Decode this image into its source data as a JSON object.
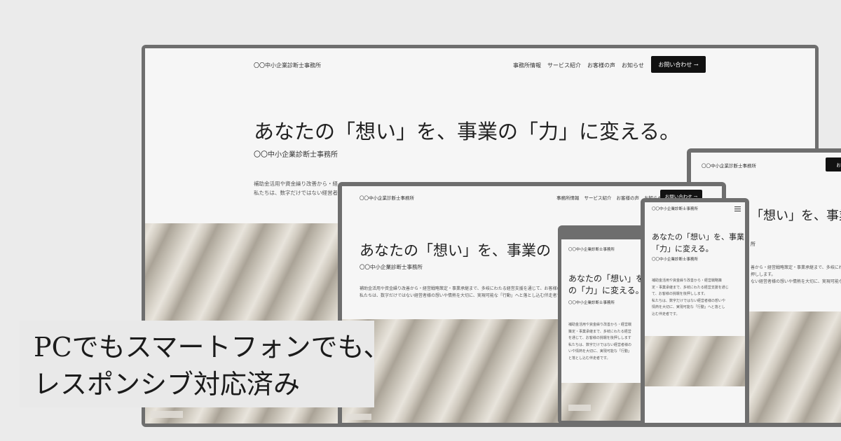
{
  "site": {
    "logo": "〇〇中小企業診断士事務所",
    "nav": [
      "事務所情報",
      "サービス紹介",
      "お客様の声",
      "お知らせ"
    ],
    "cta": "お問い合わせ →",
    "cta_short": "お問い",
    "headline": "あなたの「想い」を、事業の「力」に変える。",
    "headline_lines": [
      "あなたの「想い」を、事業の",
      "「力」に変える。"
    ],
    "headline_lines_tablet": [
      "あなたの「想い」を、事",
      "の「力」に変える。"
    ],
    "headline_partial": "「想い」を、事業の",
    "subtitle": "〇〇中小企業診断士事務所",
    "paragraph_desktop": [
      "補助金活用や資金繰り改善から・経営戦略策定・事業承継まで、多岐にわたる経営支援を通じて、お客様の挑戦を後押しします。",
      "私たちは、数字だけではない経営者様の想いや情熱を大切に、実現可能な「行動」へと落とし込む伴走者です。"
    ],
    "paragraph_mobile": [
      "補助金活用や資金繰り改善から・経営戦略策",
      "定・事業承継まで、多岐にわたる経営支援を通じ",
      "て、お客様の挑戦を後押しします。",
      "私たちは、数字だけではない経営者様の想いや",
      "情熱を大切に、実現可能な「行動」へと落とし",
      "込む伴走者です。"
    ],
    "paragraph_tablet": [
      "補助金活用や資金繰り改善から・経営戦",
      "策定・事業承継まで、多岐にわたる経営",
      "を通じて、お客様の挑戦を後押しします",
      "私たちは、数字だけではない経営者様の",
      "いや情熱を大切に、実現可能な「行動」",
      "と落とし込む伴走者です。"
    ],
    "paragraph_right": [
      "善から・経営戦略策定・事業承継まで、多岐にわ",
      "押しします。",
      "ない経営者様の想いや情熱を大切に、実現可能な"
    ],
    "subtitle_partial": "所"
  },
  "caption": {
    "line1": "PCでもスマートフォンでも、",
    "line2": "レスポンシブ対応済み"
  }
}
